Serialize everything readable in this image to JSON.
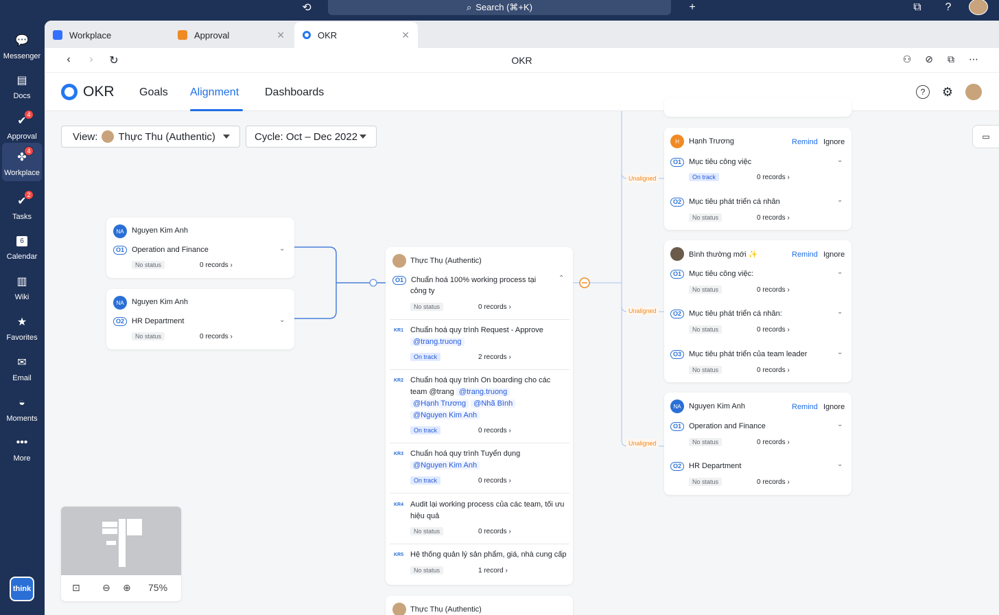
{
  "topbar": {
    "search_label": "Search (⌘+K)"
  },
  "sidebar": {
    "items": [
      {
        "label": "Messenger",
        "icon": "messenger-icon",
        "badge": ""
      },
      {
        "label": "Docs",
        "icon": "docs-icon",
        "badge": ""
      },
      {
        "label": "Approval",
        "icon": "approval-icon",
        "badge": "4"
      },
      {
        "label": "Workplace",
        "icon": "workplace-icon",
        "badge": "4"
      },
      {
        "label": "Tasks",
        "icon": "tasks-icon",
        "badge": "2"
      },
      {
        "label": "Calendar",
        "icon": "calendar-icon",
        "badge": ""
      },
      {
        "label": "Wiki",
        "icon": "wiki-icon",
        "badge": ""
      },
      {
        "label": "Favorites",
        "icon": "star-icon",
        "badge": ""
      },
      {
        "label": "Email",
        "icon": "email-icon",
        "badge": ""
      },
      {
        "label": "Moments",
        "icon": "moments-icon",
        "badge": ""
      },
      {
        "label": "More",
        "icon": "more-icon",
        "badge": ""
      }
    ],
    "brand": "think",
    "calendar_day": "6"
  },
  "tabs": [
    {
      "label": "Workplace"
    },
    {
      "label": "Approval"
    },
    {
      "label": "OKR"
    }
  ],
  "addressbar": {
    "title": "OKR"
  },
  "okr": {
    "title": "OKR",
    "nav": [
      "Goals",
      "Alignment",
      "Dashboards"
    ],
    "view_label": "View:",
    "view_value": "Thực Thu (Authentic)",
    "cycle_value": "Cycle: Oct – Dec 2022"
  },
  "left_cards": [
    {
      "avatar": "NA",
      "name": "Nguyen Kim Anh",
      "obj": "O1",
      "title": "Operation and Finance",
      "status": "No status",
      "records": "0 records"
    },
    {
      "avatar": "NA",
      "name": "Nguyen Kim Anh",
      "obj": "O2",
      "title": "HR Department",
      "status": "No status",
      "records": "0 records"
    }
  ],
  "center_card": {
    "name": "Thực Thụ (Authentic)",
    "obj": "O1",
    "title_line1": "Chuẩn hoá 100% working process tại",
    "title_line2": "công ty",
    "status": "No status",
    "records": "0 records",
    "krs": [
      {
        "id": "KR1",
        "text": "Chuẩn hoá quy trình Request - Approve",
        "mentions": [
          "@trang.truong"
        ],
        "status": "On track",
        "records": "2 records"
      },
      {
        "id": "KR2",
        "text": "Chuẩn hoá quy trình On boarding cho các",
        "text2": "team @trang",
        "mentions": [
          "@trang.truong",
          "@Hạnh Trương",
          "@Nhã Bình",
          "@Nguyen Kim Anh"
        ],
        "status": "On track",
        "records": "0 records"
      },
      {
        "id": "KR3",
        "text": "Chuẩn hoá quy trình Tuyển dụng",
        "mentions": [
          "@Nguyen Kim Anh"
        ],
        "status": "On track",
        "records": "0 records"
      },
      {
        "id": "KR4",
        "text": "Audit lại working process của các team, tối ưu",
        "text2": "hiệu quả",
        "status": "No status",
        "records": "0 records"
      },
      {
        "id": "KR5",
        "text": "Hệ thống quản lý sản phẩm, giá, nhà cung cấp",
        "status": "No status",
        "records": "1 record"
      }
    ],
    "bottom_name": "Thực Thụ (Authentic)"
  },
  "right_cards": [
    {
      "avatar": "H",
      "name": "Hạnh Trương",
      "remind": "Remind",
      "ignore": "Ignore",
      "objs": [
        {
          "obj": "O1",
          "title": "Mục tiêu công việc",
          "status": "On track",
          "records": "0 records"
        },
        {
          "obj": "O2",
          "title": "Mục tiêu phát triển cá nhân",
          "status": "No status",
          "records": "0 records"
        }
      ]
    },
    {
      "avatar": "",
      "name": "Bình thường mới ✨",
      "remind": "Remind",
      "ignore": "Ignore",
      "objs": [
        {
          "obj": "O1",
          "title": "Mục tiêu công việc:",
          "status": "No status",
          "records": "0 records"
        },
        {
          "obj": "O2",
          "title": "Mục tiêu phát triển cá nhân:",
          "status": "No status",
          "records": "0 records"
        },
        {
          "obj": "O3",
          "title": "Mục tiêu phát triển của team leader",
          "status": "No status",
          "records": "0 records"
        }
      ]
    },
    {
      "avatar": "NA",
      "name": "Nguyen Kim Anh",
      "remind": "Remind",
      "ignore": "Ignore",
      "objs": [
        {
          "obj": "O1",
          "title": "Operation and Finance",
          "status": "No status",
          "records": "0 records"
        },
        {
          "obj": "O2",
          "title": "HR Department",
          "status": "No status",
          "records": "0 records"
        }
      ]
    }
  ],
  "unaligned_label": "Unaligned",
  "minimap": {
    "zoom": "75%"
  },
  "colors": {
    "accent": "#1f6fe5",
    "sidebar": "#1e3157",
    "unaligned": "#f08a24"
  }
}
